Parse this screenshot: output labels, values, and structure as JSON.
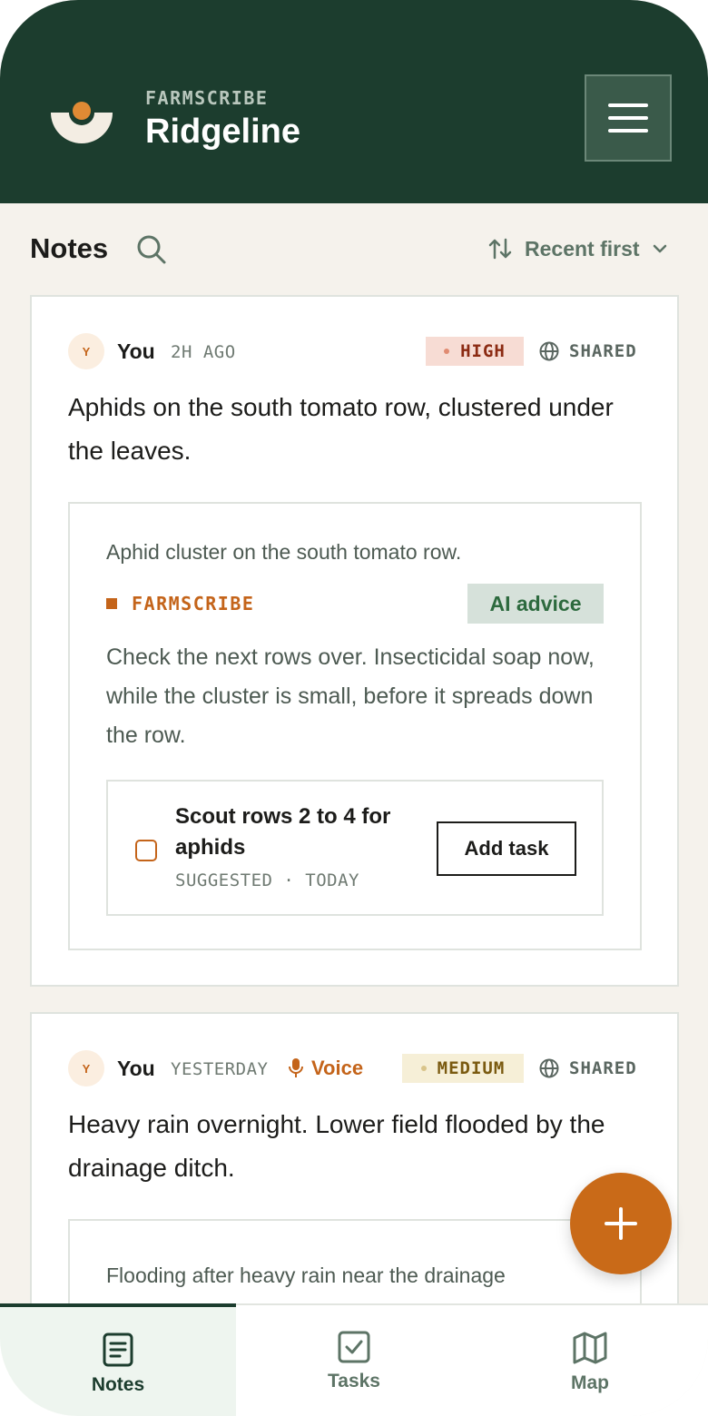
{
  "header": {
    "kicker": "FARMSCRIBE",
    "farm_name": "Ridgeline",
    "icons": {
      "logo": "farmscribe-logo",
      "menu": "hamburger-menu-icon"
    },
    "colors": {
      "background": "#1c3d2e",
      "accent": "#e08a34"
    }
  },
  "toolbar": {
    "title": "Notes",
    "search_icon": "search-icon",
    "sort_label": "Recent first",
    "sort_icon": "sort-arrows-icon"
  },
  "notes": [
    {
      "avatar": "Y",
      "author": "You",
      "time": "2H AGO",
      "priority": "HIGH",
      "visibility": "SHARED",
      "text": "Aphids on the south tomato row, clustered under the leaves.",
      "ai": {
        "summary": "Aphid cluster on the south tomato row.",
        "source": "FARMSCRIBE",
        "badge": "AI advice",
        "advice": "Check the next rows over. Insecticidal soap now, while the cluster is small, before it spreads down the row.",
        "task": {
          "title": "Scout rows 2 to 4 for aphids",
          "meta": "SUGGESTED · TODAY",
          "action": "Add task"
        }
      }
    },
    {
      "avatar": "Y",
      "author": "You",
      "time": "YESTERDAY",
      "source_type": "Voice",
      "priority": "MEDIUM",
      "visibility": "SHARED",
      "text": "Heavy rain overnight. Lower field flooded by the drainage ditch.",
      "ai": {
        "summary": "Flooding after heavy rain near the drainage ditch."
      }
    }
  ],
  "fab": {
    "icon": "plus-icon",
    "color": "#c96a18"
  },
  "bottom_nav": [
    {
      "label": "Notes",
      "icon": "notes-icon",
      "active": true
    },
    {
      "label": "Tasks",
      "icon": "task-checkbox-icon",
      "active": false
    },
    {
      "label": "Map",
      "icon": "map-icon",
      "active": false
    }
  ]
}
